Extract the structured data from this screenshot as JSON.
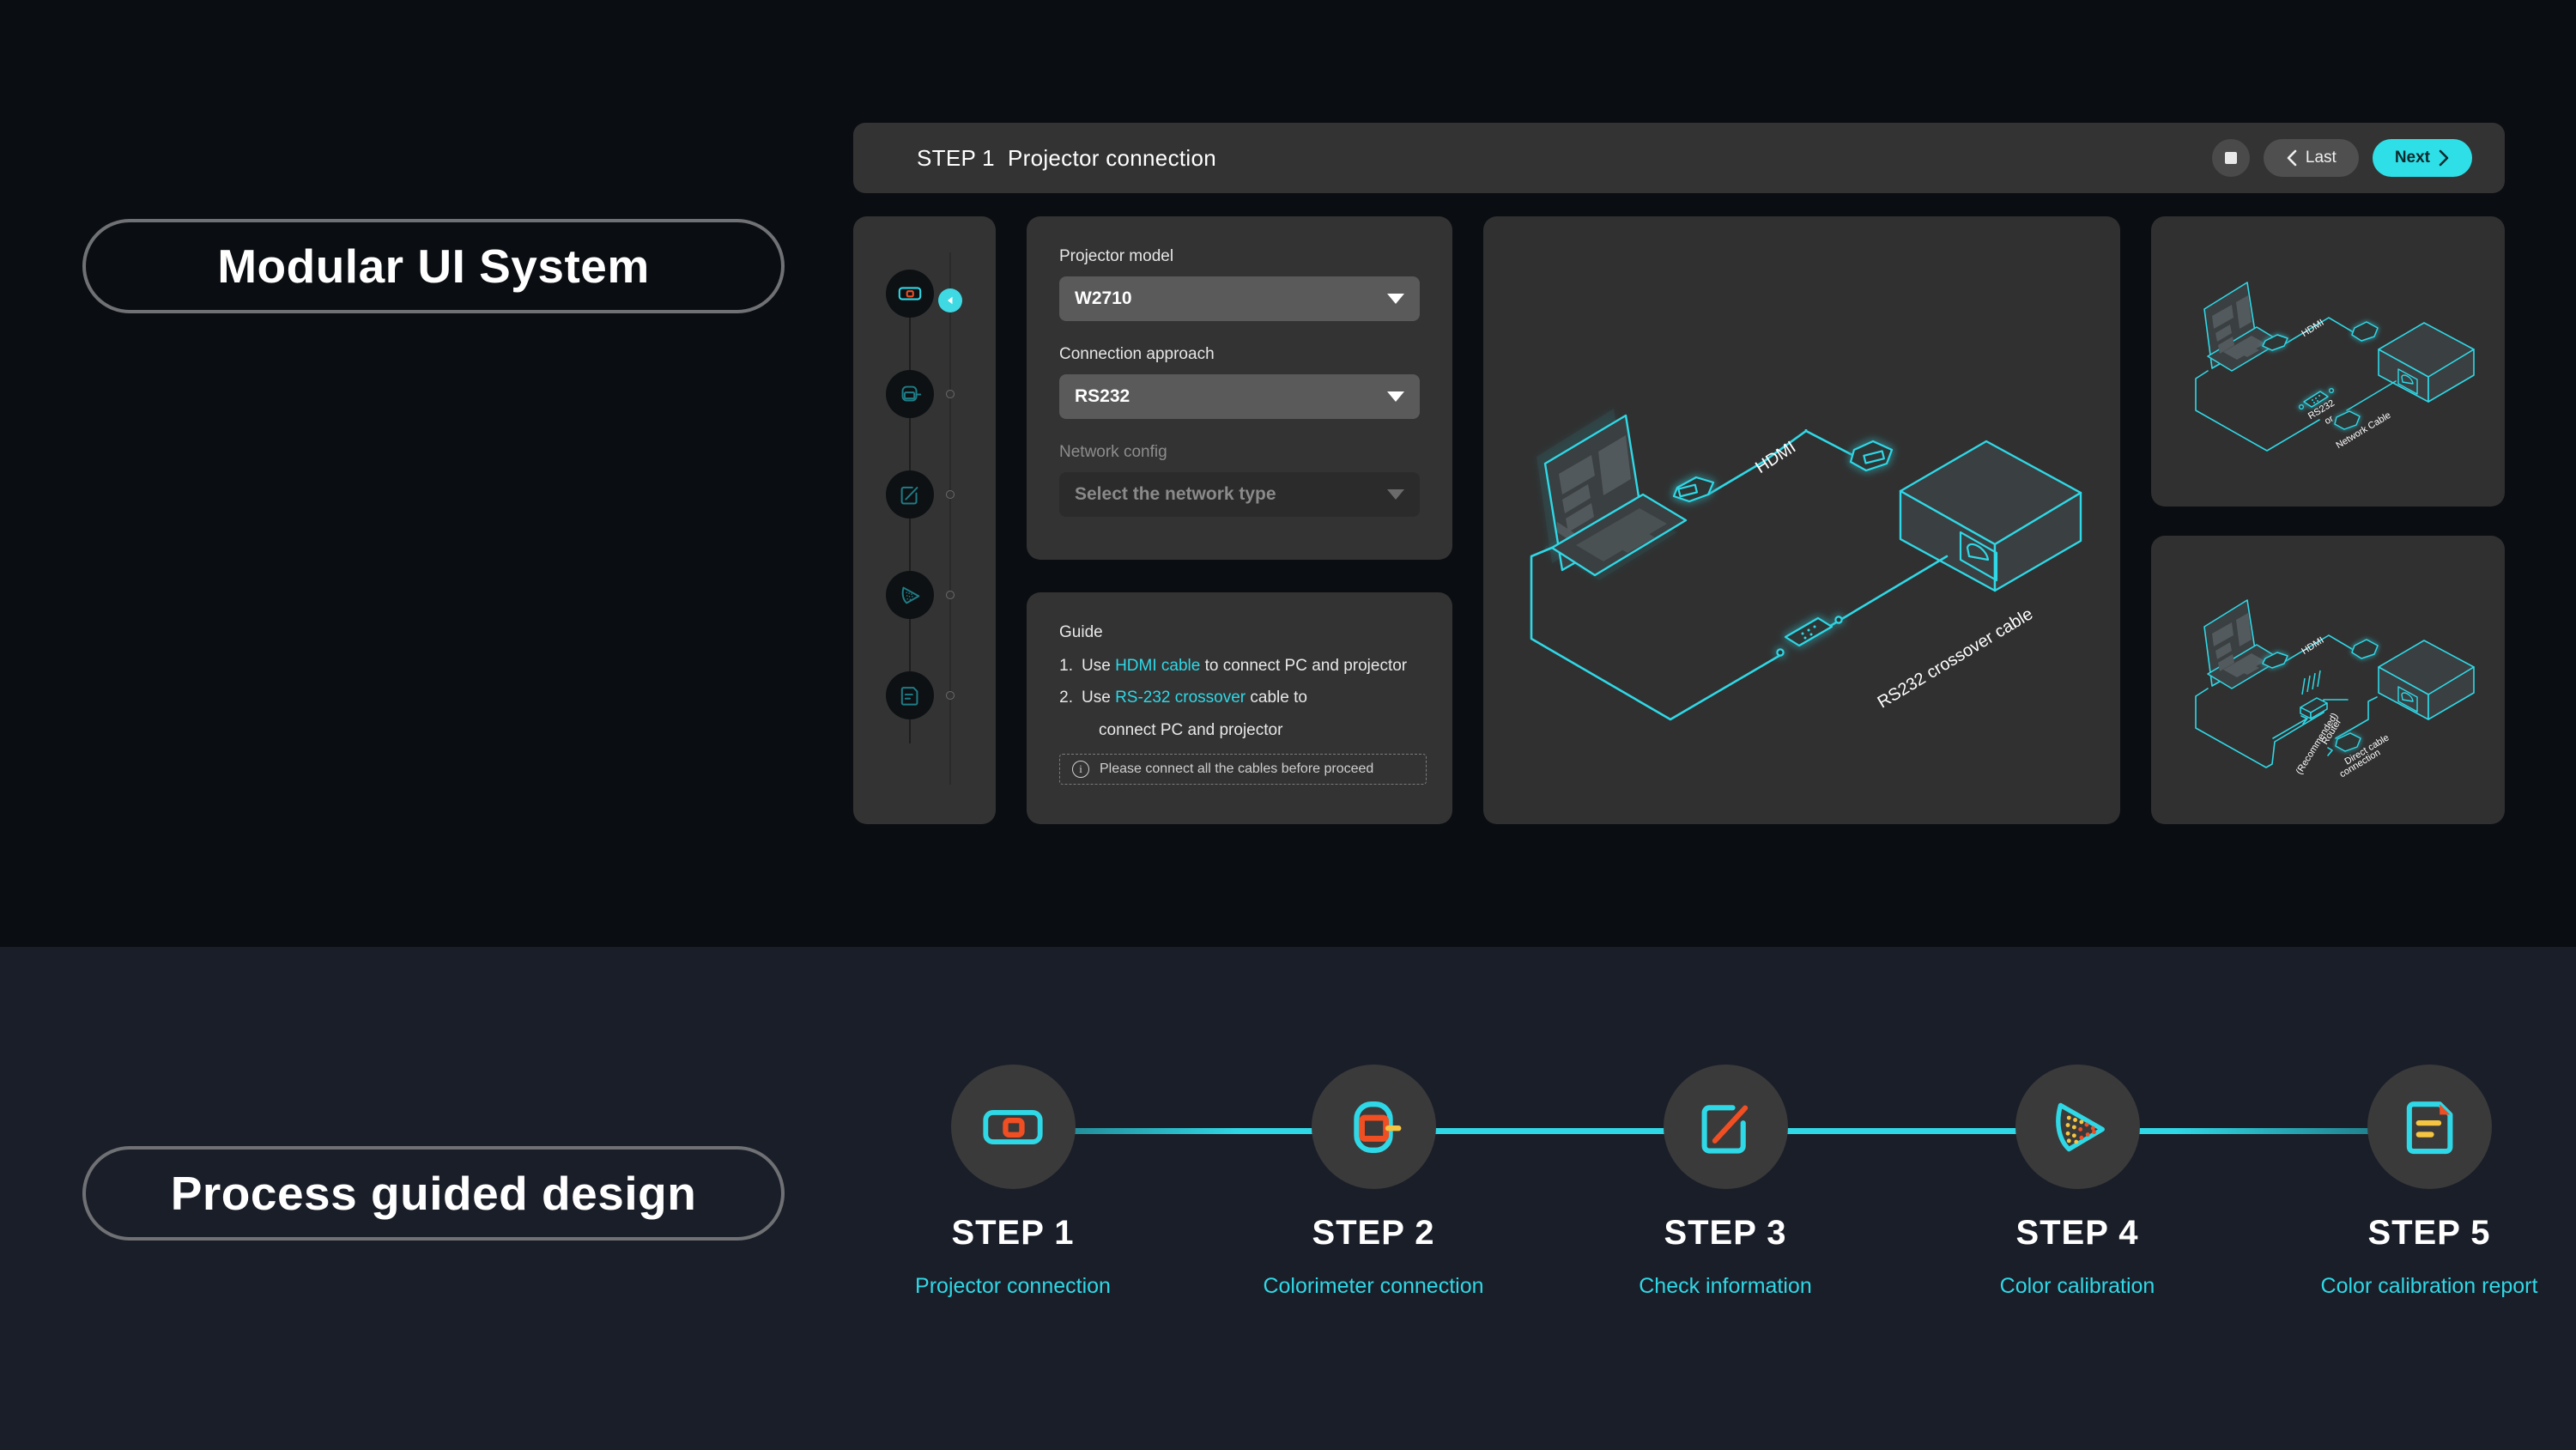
{
  "sections": {
    "top_label": "Modular UI System",
    "bottom_label": "Process guided design"
  },
  "appbar": {
    "title": "STEP 1  Projector connection",
    "stop_label": "stop-icon",
    "last_label": "Last",
    "next_label": "Next"
  },
  "sidebar_stepper": {
    "items": [
      {
        "icon": "projector-icon",
        "active": true
      },
      {
        "icon": "colorimeter-icon",
        "active": false
      },
      {
        "icon": "edit-note-icon",
        "active": false
      },
      {
        "icon": "color-gamut-icon",
        "active": false
      },
      {
        "icon": "report-document-icon",
        "active": false
      }
    ]
  },
  "form": {
    "fields": [
      {
        "label": "Projector model",
        "value": "W2710",
        "disabled": false
      },
      {
        "label": "Connection approach",
        "value": "RS232",
        "disabled": false
      },
      {
        "label": "Network config",
        "value": "Select  the network type",
        "disabled": true
      }
    ]
  },
  "guide": {
    "title": "Guide",
    "items": [
      {
        "num": "1.",
        "pre": "Use ",
        "hl": "HDMI cable",
        "post": " to connect PC and projector",
        "cont": ""
      },
      {
        "num": "2.",
        "pre": "Use ",
        "hl": "RS-232 crossover",
        "post": " cable to",
        "cont": "connect PC and projector"
      }
    ],
    "note": "Please connect all the cables before proceed",
    "note_icon": "info-icon"
  },
  "diagram": {
    "hdmi_label": "HDMI",
    "rs232_label": "RS232 crossover cable",
    "device_left": "laptop",
    "device_right": "projector"
  },
  "thumbnails": [
    {
      "name": "connection-option-cable",
      "labels": [
        "HDMI",
        "RS232",
        "or",
        "Network Cable"
      ]
    },
    {
      "name": "connection-option-network",
      "labels": [
        "HDMI",
        "Router",
        "(Recommended)",
        "Direct cable",
        "connection"
      ]
    }
  ],
  "process_steps": [
    {
      "title": "STEP 1",
      "subtitle": "Projector connection",
      "icon": "projector-icon"
    },
    {
      "title": "STEP 2",
      "subtitle": "Colorimeter connection",
      "icon": "colorimeter-icon"
    },
    {
      "title": "STEP 3",
      "subtitle": "Check information",
      "icon": "edit-note-icon"
    },
    {
      "title": "STEP 4",
      "subtitle": "Color calibration",
      "icon": "color-gamut-icon"
    },
    {
      "title": "STEP 5",
      "subtitle": "Color calibration report",
      "icon": "report-document-icon"
    }
  ],
  "colors": {
    "accent_cyan": "#2fd8e6",
    "accent_orange": "#f04e23",
    "accent_yellow": "#f5c542",
    "bg_top": "#0a0d11",
    "bg_bottom": "#1a1e28",
    "card": "#333333"
  }
}
